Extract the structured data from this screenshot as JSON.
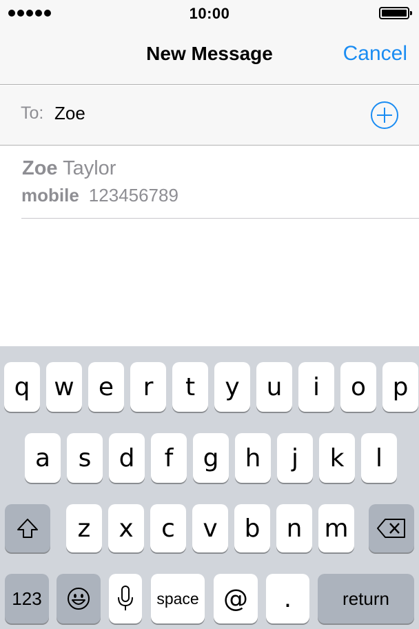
{
  "status_bar": {
    "time": "10:00",
    "signal_dots": 5,
    "battery_level": 1.0
  },
  "nav": {
    "title": "New Message",
    "cancel_label": "Cancel"
  },
  "to_field": {
    "label": "To:",
    "value": "Zoe",
    "add_icon": "plus-circle-icon"
  },
  "suggestion": {
    "name_match": "Zoe",
    "name_rest": " Taylor",
    "phone_type": "mobile",
    "phone_number": "123456789"
  },
  "keyboard": {
    "row1": [
      "q",
      "w",
      "e",
      "r",
      "t",
      "y",
      "u",
      "i",
      "o",
      "p"
    ],
    "row2": [
      "a",
      "s",
      "d",
      "f",
      "g",
      "h",
      "j",
      "k",
      "l"
    ],
    "row3": [
      "z",
      "x",
      "c",
      "v",
      "b",
      "n",
      "m"
    ],
    "shift_icon": "shift-arrow-icon",
    "delete_icon": "backspace-icon",
    "numbers_label": "123",
    "emoji_icon": "emoji-icon",
    "mic_icon": "microphone-icon",
    "space_label": "space",
    "at_label": "@",
    "dot_label": ".",
    "return_label": "return"
  },
  "colors": {
    "accent": "#1a8cf2",
    "secondary_text": "#8e8e93",
    "keyboard_bg": "#d1d5db",
    "dark_key": "#acb3bd"
  }
}
